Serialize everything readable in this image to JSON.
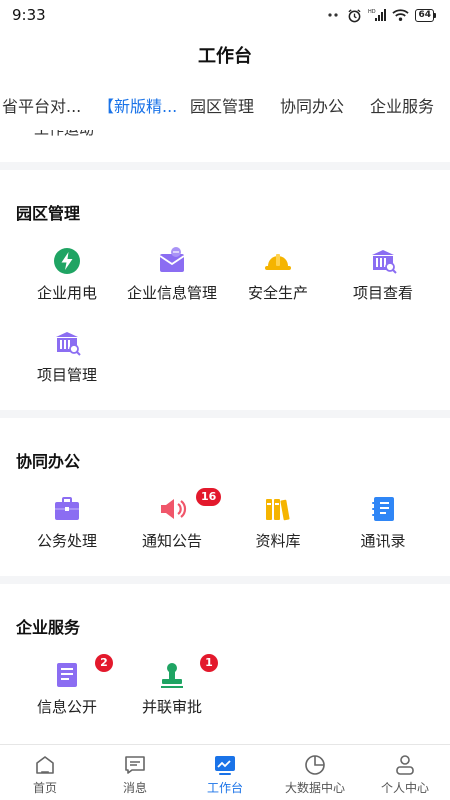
{
  "status_bar": {
    "time": "9:33",
    "battery": "64",
    "network_tag": "HD"
  },
  "header": {
    "title": "工作台"
  },
  "tabs": [
    {
      "label": "省平台对..."
    },
    {
      "label": "【新版精...",
      "active": true
    },
    {
      "label": "园区管理"
    },
    {
      "label": "协同办公"
    },
    {
      "label": "企业服务"
    }
  ],
  "partial_section": {
    "label": "工作运动"
  },
  "sections": {
    "park": {
      "title": "园区管理",
      "items": [
        {
          "label": "企业用电",
          "icon": "lightning-icon",
          "color": "#1fa463"
        },
        {
          "label": "企业信息管理",
          "icon": "envelope-icon",
          "color": "#8b6df2"
        },
        {
          "label": "安全生产",
          "icon": "hardhat-icon",
          "color": "#f5b400"
        },
        {
          "label": "项目查看",
          "icon": "building-search-icon",
          "color": "#8b6df2"
        },
        {
          "label": "项目管理",
          "icon": "building-search-icon",
          "color": "#8b6df2"
        }
      ]
    },
    "collab": {
      "title": "协同办公",
      "items": [
        {
          "label": "公务处理",
          "icon": "briefcase-icon",
          "color": "#8b6df2"
        },
        {
          "label": "通知公告",
          "icon": "speaker-icon",
          "color": "#f0566a",
          "badge": "16"
        },
        {
          "label": "资料库",
          "icon": "books-icon",
          "color": "#f5b400"
        },
        {
          "label": "通讯录",
          "icon": "contacts-icon",
          "color": "#2f86f6"
        }
      ]
    },
    "service": {
      "title": "企业服务",
      "items": [
        {
          "label": "信息公开",
          "icon": "document-icon",
          "color": "#8b6df2",
          "badge": "2"
        },
        {
          "label": "并联审批",
          "icon": "stamp-icon",
          "color": "#1fa463",
          "badge": "1"
        }
      ]
    }
  },
  "bottom_nav": [
    {
      "label": "首页",
      "icon": "home-icon"
    },
    {
      "label": "消息",
      "icon": "message-icon"
    },
    {
      "label": "工作台",
      "icon": "workbench-icon",
      "active": true
    },
    {
      "label": "大数据中心",
      "icon": "pie-chart-icon"
    },
    {
      "label": "个人中心",
      "icon": "person-icon"
    }
  ],
  "colors": {
    "accent": "#1a73e8",
    "badge": "#e3192c",
    "background": "#f4f5f7"
  }
}
